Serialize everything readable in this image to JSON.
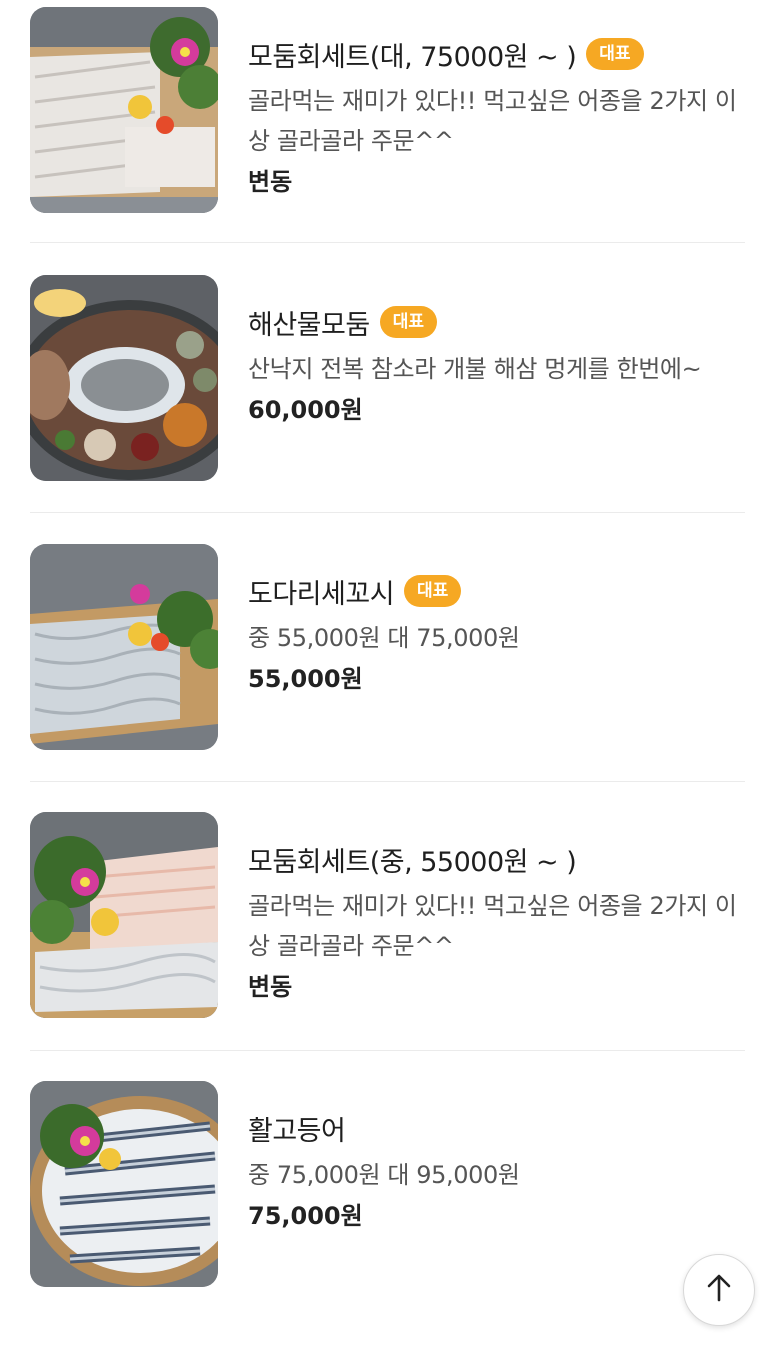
{
  "menu": {
    "items": [
      {
        "name": "모둠회세트(대, 75000원 ~ )",
        "badge": "대표",
        "description": "골라먹는 재미가 있다!! 먹고싶은 어종을 2가지 이상 골라골라 주문^^",
        "price": "변동",
        "image": "sashimi-platter-large"
      },
      {
        "name": "해산물모둠",
        "badge": "대표",
        "description": "산낙지 전복 참소라 개불 해삼 멍게를 한번에~",
        "price": "60,000원",
        "image": "seafood-platter"
      },
      {
        "name": "도다리세꼬시",
        "badge": "대표",
        "description": "중 55,000원 대 75,000원",
        "price": "55,000원",
        "image": "flounder-sliced"
      },
      {
        "name": "모둠회세트(중, 55000원 ~ )",
        "badge": "",
        "description": "골라먹는 재미가 있다!! 먹고싶은 어종을 2가지 이상 골라골라 주문^^",
        "price": "변동",
        "image": "sashimi-platter-medium"
      },
      {
        "name": "활고등어",
        "badge": "",
        "description": "중 75,000원 대 95,000원",
        "price": "75,000원",
        "image": "live-mackerel"
      }
    ]
  },
  "scroll_top_icon": "arrow-up-icon",
  "colors": {
    "badge": "#f6a823",
    "divider": "#ebebeb"
  }
}
